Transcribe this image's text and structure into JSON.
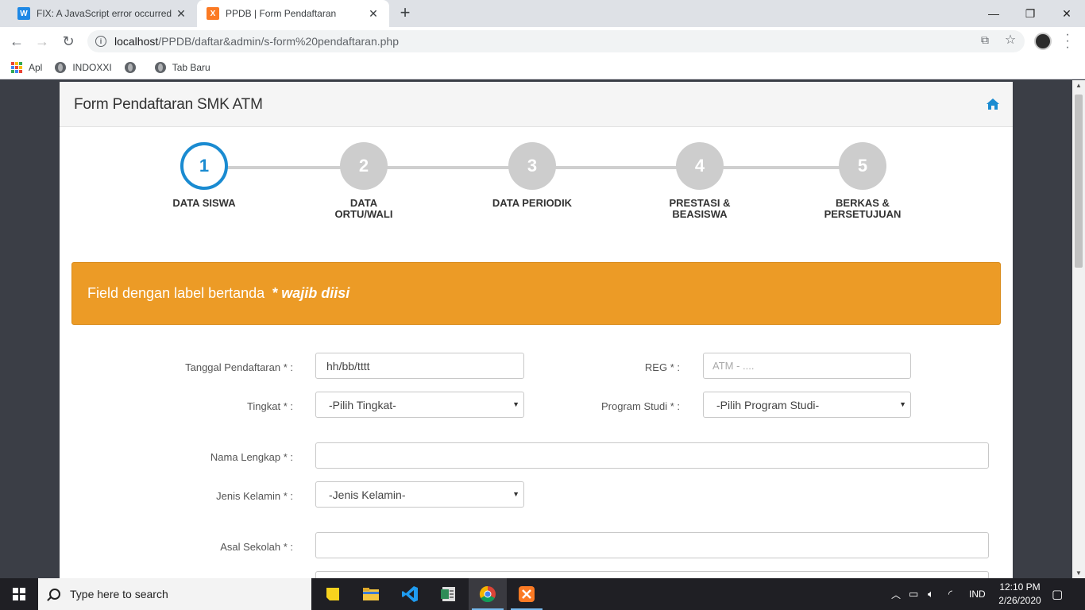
{
  "browser": {
    "tabs": [
      {
        "title": "FIX: A JavaScript error occurred in",
        "favicon": "W"
      },
      {
        "title": "PPDB | Form Pendaftaran",
        "favicon": "X"
      }
    ],
    "url_host": "localhost",
    "url_path": "/PPDB/daftar&admin/s-form%20pendaftaran.php",
    "bookmarks": [
      "Apl",
      "INDOXXI",
      "Tab Baru"
    ]
  },
  "page": {
    "panel_title": "Form Pendaftaran SMK ATM",
    "steps": [
      {
        "num": "1",
        "label_line1": "DATA SISWA",
        "label_line2": ""
      },
      {
        "num": "2",
        "label_line1": "DATA",
        "label_line2": "ORTU/WALI"
      },
      {
        "num": "3",
        "label_line1": "DATA PERIODIK",
        "label_line2": ""
      },
      {
        "num": "4",
        "label_line1": "PRESTASI &",
        "label_line2": "BEASISWA"
      },
      {
        "num": "5",
        "label_line1": "BERKAS &",
        "label_line2": "PERSETUJUAN"
      }
    ],
    "active_step": 1,
    "alert_text": "Field dengan label bertanda",
    "alert_strong": "* wajib diisi",
    "colors": {
      "accent": "#1a8bd1",
      "alert": "#ec9b26"
    },
    "form": {
      "tanggal_label": "Tanggal Pendaftaran * :",
      "tanggal_value": "hh/bb/tttt",
      "reg_label": "REG * :",
      "reg_placeholder": "ATM - ....",
      "tingkat_label": "Tingkat * :",
      "tingkat_value": "-Pilih Tingkat-",
      "prodi_label": "Program Studi * :",
      "prodi_value": "-Pilih Program Studi-",
      "nama_label": "Nama Lengkap * :",
      "nama_value": "",
      "jk_label": "Jenis Kelamin * :",
      "jk_value": "-Jenis Kelamin-",
      "asal_label": "Asal Sekolah * :",
      "asal_value": ""
    }
  },
  "taskbar": {
    "search_placeholder": "Type here to search",
    "language": "IND",
    "time": "12:10 PM",
    "date": "2/26/2020"
  }
}
